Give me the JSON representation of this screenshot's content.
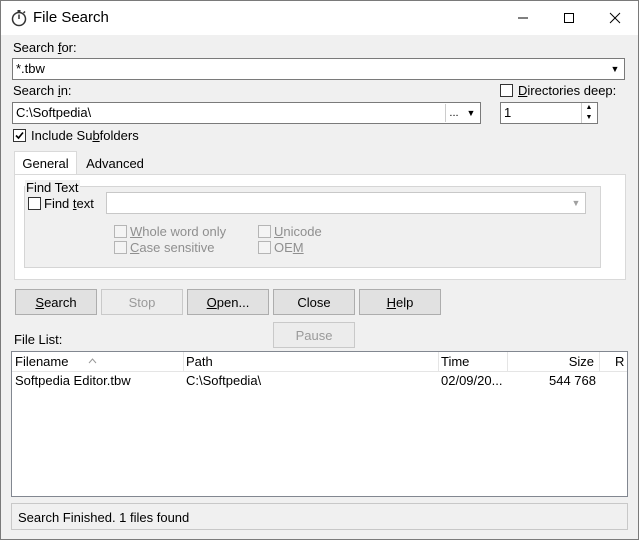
{
  "window": {
    "title": "File Search",
    "controls": {
      "minimize": "minimize-icon",
      "maximize": "maximize-icon",
      "close": "close-icon"
    }
  },
  "search_for": {
    "label_pre": "Search ",
    "label_u": "f",
    "label_post": "or:",
    "value": "*.tbw"
  },
  "search_in": {
    "label_pre": "Search ",
    "label_u": "i",
    "label_post": "n:",
    "value": "C:\\Softpedia\\",
    "browse_label": "..."
  },
  "directories_deep": {
    "label_u": "D",
    "label_post": "irectories deep:",
    "value": "1",
    "checked": false
  },
  "include_subfolders": {
    "label_pre": "Include Su",
    "label_u": "b",
    "label_post": "folders",
    "checked": true
  },
  "tabs": [
    {
      "label": "General",
      "active": true
    },
    {
      "label": "Advanced",
      "active": false
    }
  ],
  "find_text_group": {
    "title": "Find Text",
    "find_text_pre": "Find ",
    "find_text_u": "t",
    "find_text_post": "ext",
    "value": "",
    "options": {
      "whole_word": {
        "pre": "",
        "u": "W",
        "post": "hole word only"
      },
      "case_sensitive": {
        "pre": "",
        "u": "C",
        "post": "ase sensitive"
      },
      "unicode": {
        "pre": "",
        "u": "U",
        "post": "nicode"
      },
      "oem": {
        "pre": "OE",
        "u": "M",
        "post": ""
      }
    }
  },
  "buttons": {
    "search": {
      "pre": "",
      "u": "S",
      "post": "earch"
    },
    "stop": {
      "label": "Stop"
    },
    "open": {
      "pre": "",
      "u": "O",
      "post": "pen..."
    },
    "close": {
      "label": "Close"
    },
    "help": {
      "pre": "",
      "u": "H",
      "post": "elp"
    },
    "pause": {
      "label": "Pause"
    }
  },
  "file_list": {
    "label": "File List:",
    "columns": [
      "Filename",
      "Path",
      "Time",
      "Size",
      "R"
    ],
    "rows": [
      {
        "filename": "Softpedia Editor.tbw",
        "path": "C:\\Softpedia\\",
        "time": "02/09/20...",
        "size": "544 768"
      }
    ]
  },
  "status": {
    "text": "Search Finished. 1 files found"
  },
  "colors": {
    "window_bg": "#f0f0f0",
    "titlebar_bg": "#ffffff",
    "disabled_text": "#8f8f8f"
  }
}
